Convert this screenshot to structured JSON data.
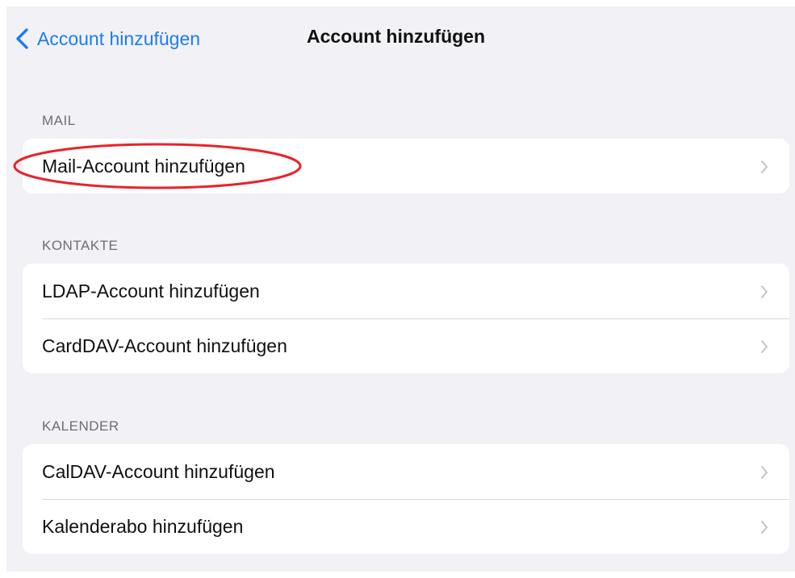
{
  "nav": {
    "back_label": "Account hinzufügen",
    "title": "Account hinzufügen",
    "back_icon": "chevron-left-icon",
    "accent_color": "#1a7cf5"
  },
  "sections": [
    {
      "header": "MAIL",
      "rows": [
        {
          "label": "Mail-Account hinzufügen"
        }
      ]
    },
    {
      "header": "KONTAKTE",
      "rows": [
        {
          "label": "LDAP-Account hinzufügen"
        },
        {
          "label": "CardDAV-Account hinzufügen"
        }
      ]
    },
    {
      "header": "KALENDER",
      "rows": [
        {
          "label": "CalDAV-Account hinzufügen"
        },
        {
          "label": "Kalenderabo hinzufügen"
        }
      ]
    }
  ],
  "row_icon": "chevron-right-icon",
  "annotation": {
    "shape": "ellipse",
    "color": "#e8232a",
    "target": "Mail-Account hinzufügen"
  }
}
